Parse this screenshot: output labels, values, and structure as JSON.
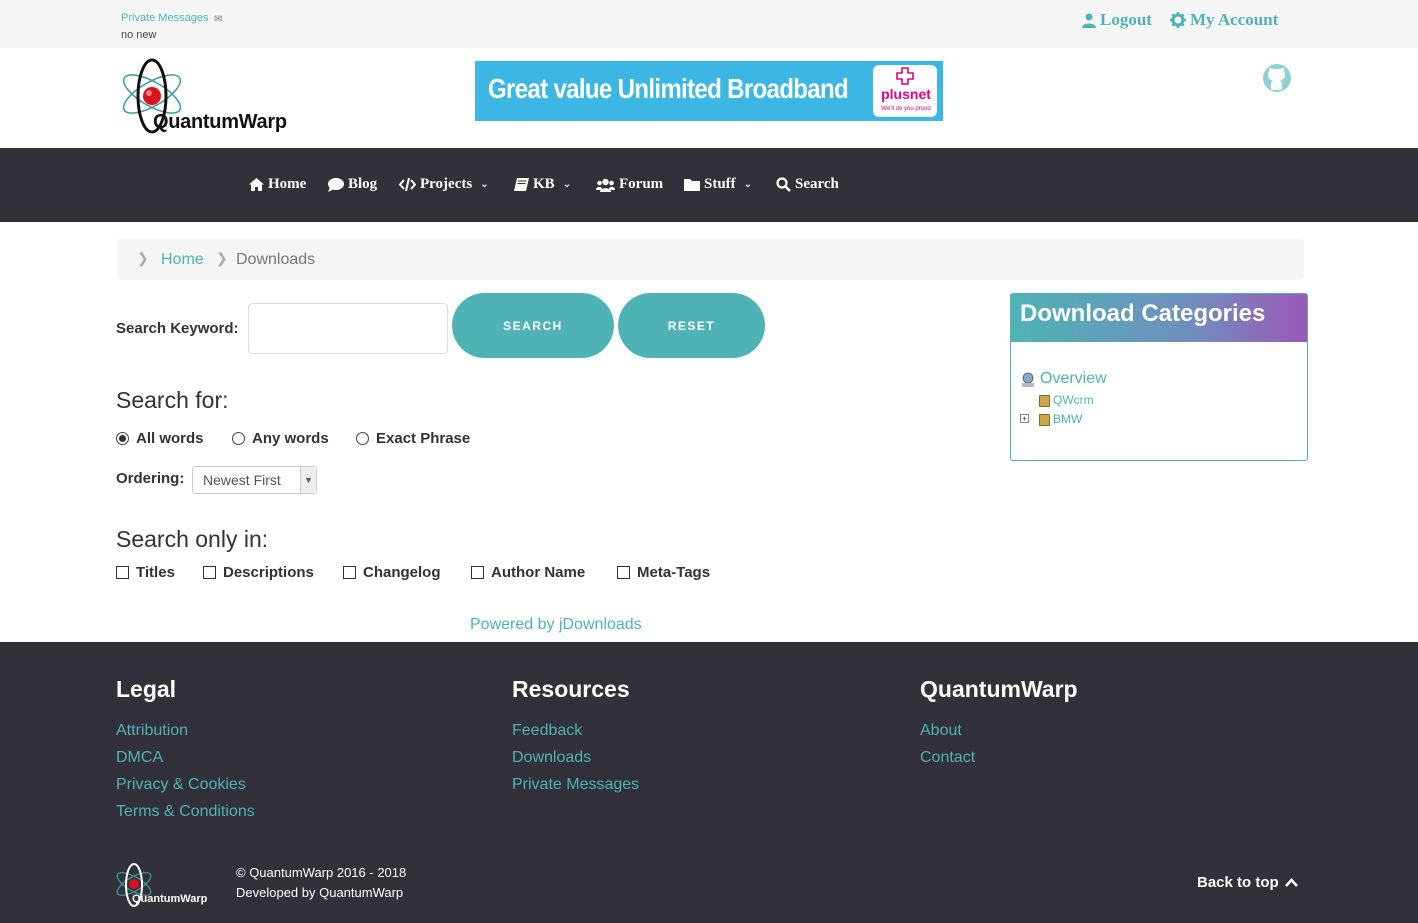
{
  "topbar": {
    "private_messages": "Private Messages",
    "pm_status": "no new",
    "logout": "Logout",
    "my_account": "My Account"
  },
  "header": {
    "logo_text": "QuantumWarp",
    "banner_text": "Great value Unlimited Broadband",
    "banner_brand": "plusnet",
    "banner_tagline": "We'll do you proud"
  },
  "nav": {
    "items": [
      {
        "label": "Home",
        "icon": "home-icon"
      },
      {
        "label": "Blog",
        "icon": "comment-icon"
      },
      {
        "label": "Projects",
        "icon": "code-icon"
      },
      {
        "label": "KB",
        "icon": "book-icon"
      },
      {
        "label": "Forum",
        "icon": "users-icon"
      },
      {
        "label": "Stuff",
        "icon": "folder-icon"
      },
      {
        "label": "Search",
        "icon": "search-icon"
      }
    ]
  },
  "breadcrumb": {
    "home": "Home",
    "current": "Downloads"
  },
  "search": {
    "keyword_label": "Search Keyword:",
    "keyword_value": "",
    "search_button": "SEARCH",
    "reset_button": "RESET",
    "search_for_heading": "Search for:",
    "radio_all": "All words",
    "radio_any": "Any words",
    "radio_exact": "Exact Phrase",
    "selected_radio": "All words",
    "ordering_label": "Ordering:",
    "ordering_value": "Newest First",
    "search_only_heading": "Search only in:",
    "checks": [
      "Titles",
      "Descriptions",
      "Changelog",
      "Author Name",
      "Meta-Tags"
    ]
  },
  "powered_by": "Powered by jDownloads",
  "categories": {
    "title": "Download Categories",
    "overview": "Overview",
    "items": [
      "QWcrm",
      "BMW"
    ]
  },
  "footer": {
    "col1": {
      "heading": "Legal",
      "links": [
        "Attribution",
        "DMCA",
        "Privacy & Cookies",
        "Terms & Conditions"
      ]
    },
    "col2": {
      "heading": "Resources",
      "links": [
        "Feedback",
        "Downloads",
        "Private Messages"
      ]
    },
    "col3": {
      "heading": "QuantumWarp",
      "links": [
        "About",
        "Contact"
      ]
    },
    "logo_text": "QuantumWarp",
    "copyright": "© QuantumWarp 2016 - 2018",
    "developed_by": "Developed by QuantumWarp",
    "back_to_top": "Back to top"
  },
  "colors": {
    "accent": "#4fb3b5",
    "nav_bg": "#323038",
    "footer_bg": "#323038",
    "category_gradient_end": "#9b59b6"
  }
}
